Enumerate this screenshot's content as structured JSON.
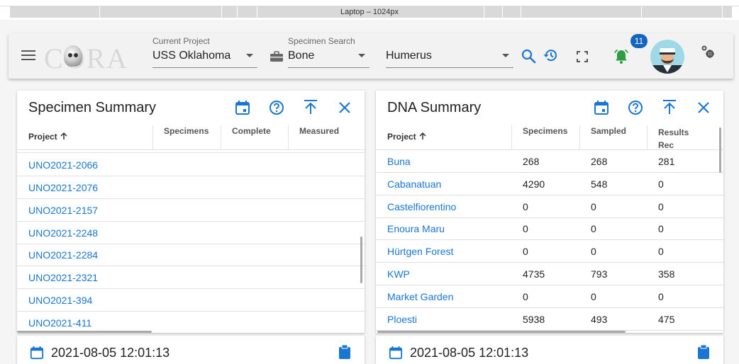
{
  "viewport_label": "Laptop – 1024px",
  "appbar": {
    "logo_text": "CORA",
    "current_project": {
      "label": "Current Project",
      "value": "USS Oklahoma"
    },
    "specimen_search": {
      "label": "Specimen Search",
      "value": "Bone"
    },
    "bone_select": {
      "value": "Humerus"
    },
    "notification_count": "11"
  },
  "specimen_summary": {
    "title": "Specimen Summary",
    "columns": [
      "Project",
      "Specimens",
      "Complete",
      "Measured"
    ],
    "rows": [
      "UNO2021-2066",
      "UNO2021-2076",
      "UNO2021-2157",
      "UNO2021-2248",
      "UNO2021-2284",
      "UNO2021-2321",
      "UNO2021-394",
      "UNO2021-411"
    ],
    "footer_timestamp": "2021-08-05 12:01:13"
  },
  "dna_summary": {
    "title": "DNA Summary",
    "columns": [
      "Project",
      "Specimens",
      "Sampled",
      "Results",
      "Rec"
    ],
    "rows": [
      {
        "name": "Buna",
        "specimens": "268",
        "sampled": "268",
        "results": "281"
      },
      {
        "name": "Cabanatuan",
        "specimens": "4290",
        "sampled": "548",
        "results": "0"
      },
      {
        "name": "Castelfiorentino",
        "specimens": "0",
        "sampled": "0",
        "results": "0"
      },
      {
        "name": "Enoura Maru",
        "specimens": "0",
        "sampled": "0",
        "results": "0"
      },
      {
        "name": "Hürtgen Forest",
        "specimens": "0",
        "sampled": "0",
        "results": "0"
      },
      {
        "name": "KWP",
        "specimens": "4735",
        "sampled": "793",
        "results": "358"
      },
      {
        "name": "Market Garden",
        "specimens": "0",
        "sampled": "0",
        "results": "0"
      },
      {
        "name": "Ploesti",
        "specimens": "5938",
        "sampled": "493",
        "results": "475"
      }
    ],
    "footer_timestamp": "2021-08-05 12:01:13"
  },
  "colors": {
    "accent": "#1976d2",
    "bell": "#2e9e44",
    "badge": "#1565c0"
  }
}
